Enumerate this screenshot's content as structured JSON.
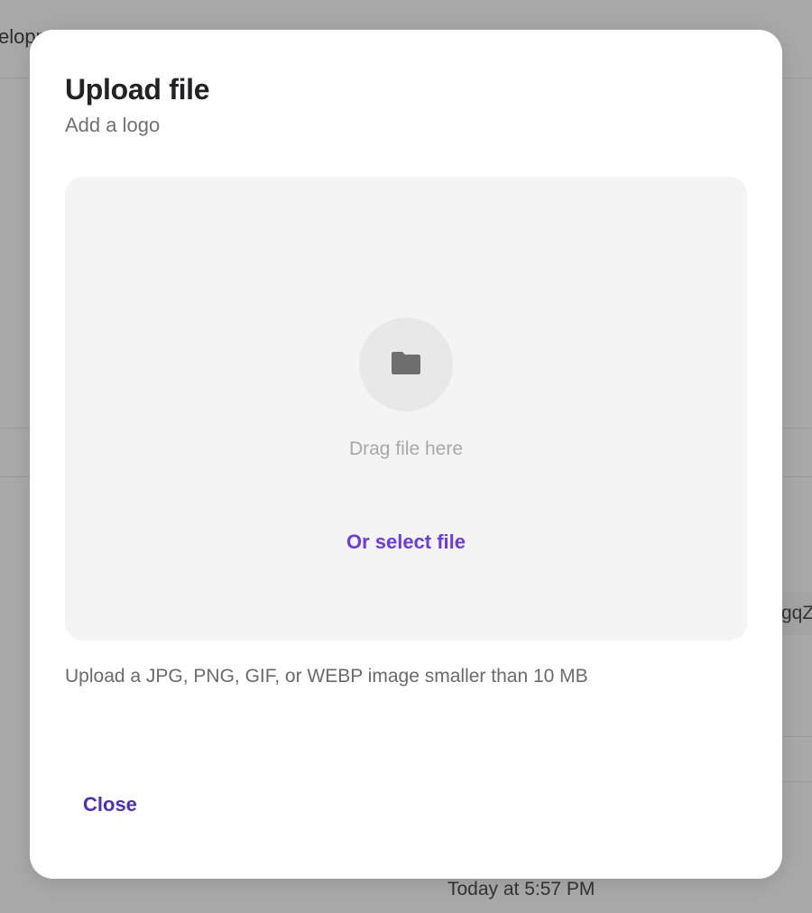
{
  "background": {
    "top_left_text": "elopment t",
    "right_clipped_text": "gqZ",
    "timestamp": "Today at 5:57 PM"
  },
  "modal": {
    "title": "Upload file",
    "subtitle": "Add a logo",
    "dropzone": {
      "icon": "folder-icon",
      "drag_text": "Drag file here",
      "select_link": "Or select file"
    },
    "hint": "Upload a JPG, PNG, GIF, or WEBP image smaller than 10 MB",
    "close_label": "Close"
  },
  "colors": {
    "overlay": "#a9a9a9",
    "modal_bg": "#ffffff",
    "dropzone_bg": "#f4f4f4",
    "accent": "#6a3be8",
    "close_accent": "#4b2fc9"
  }
}
